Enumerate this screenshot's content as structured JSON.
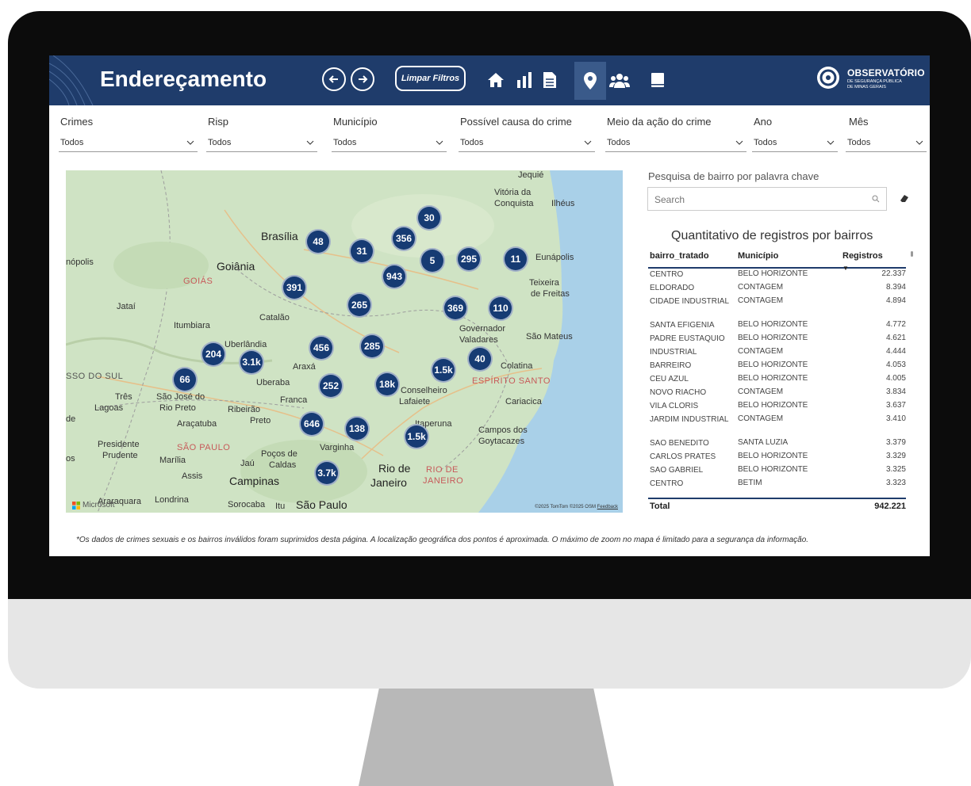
{
  "header": {
    "title": "Endereçamento",
    "clear_filters": "Limpar Filtros",
    "logo_title": "OBSERVATÓRIO",
    "logo_subtitle_1": "DE SEGURANÇA PÚBLICA",
    "logo_subtitle_2": "DE MINAS GERAIS",
    "nav_icons": [
      "back-arrow-icon",
      "forward-arrow-icon",
      "home-icon",
      "bar-chart-icon",
      "document-icon",
      "map-pin-icon",
      "people-icon",
      "book-icon"
    ]
  },
  "filters": [
    {
      "label": "Crimes",
      "value": "Todos"
    },
    {
      "label": "Risp",
      "value": "Todos"
    },
    {
      "label": "Município",
      "value": "Todos"
    },
    {
      "label": "Possível causa do crime",
      "value": "Todos"
    },
    {
      "label": "Meio da ação do crime",
      "value": "Todos"
    },
    {
      "label": "Ano",
      "value": "Todos"
    },
    {
      "label": "Mês",
      "value": "Todos"
    }
  ],
  "map": {
    "places": [
      "Jequié",
      "Vitória da",
      "Conquista",
      "Ilhéus",
      "Brasília",
      "Eunápolis",
      "Goiânia",
      "Teixeira",
      "de Freitas",
      "GOIÁS",
      "Jataí",
      "Catalão",
      "Itumbiara",
      "Governador",
      "Valadares",
      "São Mateus",
      "Uberlândia",
      "Colatina",
      "Araxá",
      "SSO DO SUL",
      "Uberaba",
      "Conselheiro",
      "ESPÍRITO SANTO",
      "Lafaiete",
      "Cariacica",
      "Três",
      "Lagoas",
      "São José do",
      "Rio Preto",
      "Franca",
      "Ribeirão",
      "Preto",
      "Araçatuba",
      "Itaperuna",
      "Campos dos",
      "Goytacazes",
      "Presidente",
      "Prudente",
      "SÃO PAULO",
      "Varginha",
      "Poços de",
      "Caldas",
      "Jaú",
      "Marília",
      "Assis",
      "Rio de",
      "Janeiro",
      "RIO DE",
      "JANEIRO",
      "Campinas",
      "Araraquara",
      "Londrina",
      "Sorocaba",
      "Itu",
      "São Paulo",
      "nópolis",
      "de",
      "os"
    ],
    "clusters": [
      "30",
      "48",
      "356",
      "31",
      "5",
      "295",
      "11",
      "943",
      "391",
      "265",
      "369",
      "110",
      "285",
      "204",
      "456",
      "3.1k",
      "40",
      "1.5k",
      "66",
      "252",
      "18k",
      "646",
      "138",
      "1.5k",
      "3.7k"
    ],
    "attribution": "©2025 TomTom ©2025 OSM",
    "feedback": "Feedback",
    "provider": "Microsoft"
  },
  "search": {
    "label": "Pesquisa de bairro por palavra chave",
    "placeholder": "Search"
  },
  "table": {
    "title": "Quantitativo de registros por bairros",
    "columns": [
      "bairro_tratado",
      "Município",
      "Registros"
    ],
    "rows": [
      [
        "CENTRO",
        "BELO HORIZONTE",
        "22.337"
      ],
      [
        "ELDORADO",
        "CONTAGEM",
        "8.394"
      ],
      [
        "CIDADE INDUSTRIAL",
        "CONTAGEM",
        "4.894"
      ],
      [
        "SANTA EFIGENIA",
        "BELO HORIZONTE",
        "4.772"
      ],
      [
        "PADRE EUSTAQUIO",
        "BELO HORIZONTE",
        "4.621"
      ],
      [
        "INDUSTRIAL",
        "CONTAGEM",
        "4.444"
      ],
      [
        "BARREIRO",
        "BELO HORIZONTE",
        "4.053"
      ],
      [
        "CEU AZUL",
        "BELO HORIZONTE",
        "4.005"
      ],
      [
        "NOVO RIACHO",
        "CONTAGEM",
        "3.834"
      ],
      [
        "VILA CLORIS",
        "BELO HORIZONTE",
        "3.637"
      ],
      [
        "JARDIM INDUSTRIAL",
        "CONTAGEM",
        "3.410"
      ],
      [
        "SAO BENEDITO",
        "SANTA LUZIA",
        "3.379"
      ],
      [
        "CARLOS PRATES",
        "BELO HORIZONTE",
        "3.329"
      ],
      [
        "SAO GABRIEL",
        "BELO HORIZONTE",
        "3.325"
      ],
      [
        "CENTRO",
        "BETIM",
        "3.323"
      ]
    ],
    "total_label": "Total",
    "total_value": "942.221"
  },
  "footnote": "*Os dados de crimes sexuais e os bairros inválidos foram suprimidos desta página. A localização geográfica dos pontos é aproximada. O máximo de zoom no mapa é limitado para a segurança da informação.",
  "colors": {
    "header": "#1f3c6b",
    "cluster": "#163b73",
    "map_land": "#cfe3c4",
    "map_water": "#a9d0e8"
  }
}
